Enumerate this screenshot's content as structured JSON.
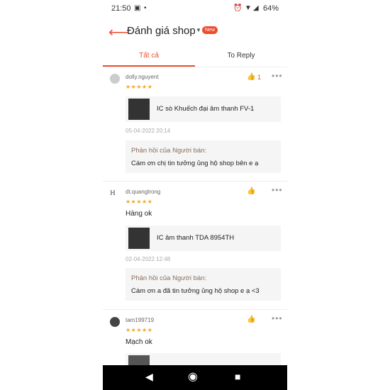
{
  "status_bar": {
    "time": "21:50",
    "battery": "64%"
  },
  "header": {
    "title": "Đánh giá shop",
    "new_badge": "New"
  },
  "tabs": [
    {
      "label": "Tất cả"
    },
    {
      "label": "To Reply"
    }
  ],
  "reviews": [
    {
      "username": "dolly.nguyent",
      "stars": "★★★★★",
      "like_count": "1",
      "comment": "",
      "product": "IC sò Khuếch đại âm thanh  FV-1",
      "date": "05-04-2022 20:14",
      "reply_label": "Phản hồi của Người bán:",
      "reply_text": "Cám ơn chị tin tưởng ủng hộ shop bên e ạ"
    },
    {
      "username": "dt.quangtrong",
      "stars": "★★★★★",
      "comment": "Hàng ok",
      "product": "IC âm thanh TDA 8954TH",
      "date": "02-04-2022 12:48",
      "reply_label": "Phản hồi của Người bán:",
      "reply_text": "Cám ơn a đã tin tưởng ủng hộ shop e ạ <3"
    },
    {
      "username": "tam199719",
      "stars": "★★★★★",
      "comment": "Mạch ok"
    }
  ],
  "icons": {
    "back": "arrow-left-icon",
    "like": "thumbs-up-icon",
    "more": "more-dots-icon"
  },
  "colors": {
    "accent": "#ee4d2d",
    "star": "#f5a623"
  }
}
